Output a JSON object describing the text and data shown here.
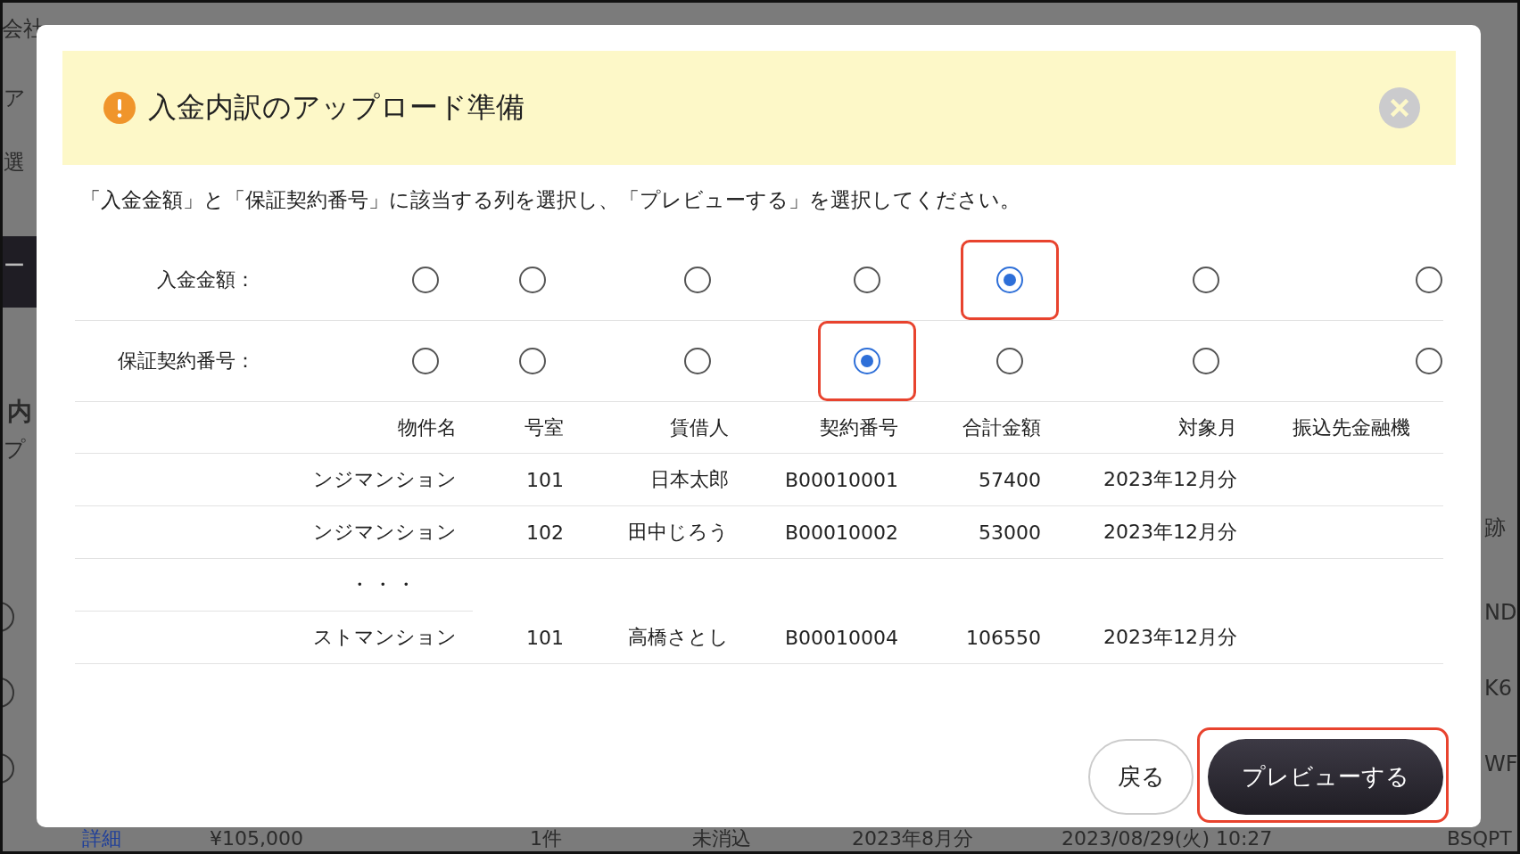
{
  "backdrop": {
    "intro": "会社",
    "left_fragments": [
      "ア",
      "選",
      "ー",
      "内",
      "プ"
    ],
    "right_fragments": [
      "跡",
      "ND",
      "K6",
      "WF"
    ],
    "bottom_row": [
      {
        "text": "詳細",
        "kind": "link"
      },
      {
        "text": "¥105,000",
        "kind": "text"
      },
      {
        "text": "1件",
        "kind": "text"
      },
      {
        "text": "未消込",
        "kind": "text"
      },
      {
        "text": "2023年8月分",
        "kind": "text"
      },
      {
        "text": "2023/08/29(火) 10:27",
        "kind": "text"
      },
      {
        "text": "BSQPT",
        "kind": "text"
      }
    ]
  },
  "dialog": {
    "title": "入金内訳のアップロード準備",
    "instruction": "「入金金額」と「保証契約番号」に該当する列を選択し、「プレビューする」を選択してください。",
    "selection_rows": [
      {
        "label": "入金金額：",
        "options": [
          {
            "selected": false,
            "highlighted": false
          },
          {
            "selected": false,
            "highlighted": false
          },
          {
            "selected": false,
            "highlighted": false
          },
          {
            "selected": false,
            "highlighted": false
          },
          {
            "selected": true,
            "highlighted": true
          },
          {
            "selected": false,
            "highlighted": false
          },
          {
            "selected": false,
            "highlighted": false
          }
        ]
      },
      {
        "label": "保証契約番号：",
        "options": [
          {
            "selected": false,
            "highlighted": false
          },
          {
            "selected": false,
            "highlighted": false
          },
          {
            "selected": false,
            "highlighted": false
          },
          {
            "selected": true,
            "highlighted": true
          },
          {
            "selected": false,
            "highlighted": false
          },
          {
            "selected": false,
            "highlighted": false
          },
          {
            "selected": false,
            "highlighted": false
          }
        ]
      }
    ],
    "table": {
      "columns": [
        "物件名",
        "号室",
        "賃借人",
        "契約番号",
        "合計金額",
        "対象月",
        "振込先金融機"
      ],
      "rows": [
        {
          "kind": "data",
          "cells": [
            "ンジマンション",
            "101",
            "日本太郎",
            "B00010001",
            "57400",
            "2023年12月分"
          ]
        },
        {
          "kind": "data",
          "cells": [
            "ンジマンション",
            "102",
            "田中じろう",
            "B00010002",
            "53000",
            "2023年12月分"
          ]
        },
        {
          "kind": "ellipsis",
          "cells": [
            "・・・"
          ]
        },
        {
          "kind": "data",
          "cells": [
            "ストマンション",
            "101",
            "高橋さとし",
            "B00010004",
            "106550",
            "2023年12月分"
          ]
        }
      ]
    },
    "buttons": [
      {
        "label": "戻る",
        "kind": "secondary",
        "highlighted": false
      },
      {
        "label": "プレビューする",
        "kind": "primary",
        "highlighted": true
      }
    ]
  }
}
